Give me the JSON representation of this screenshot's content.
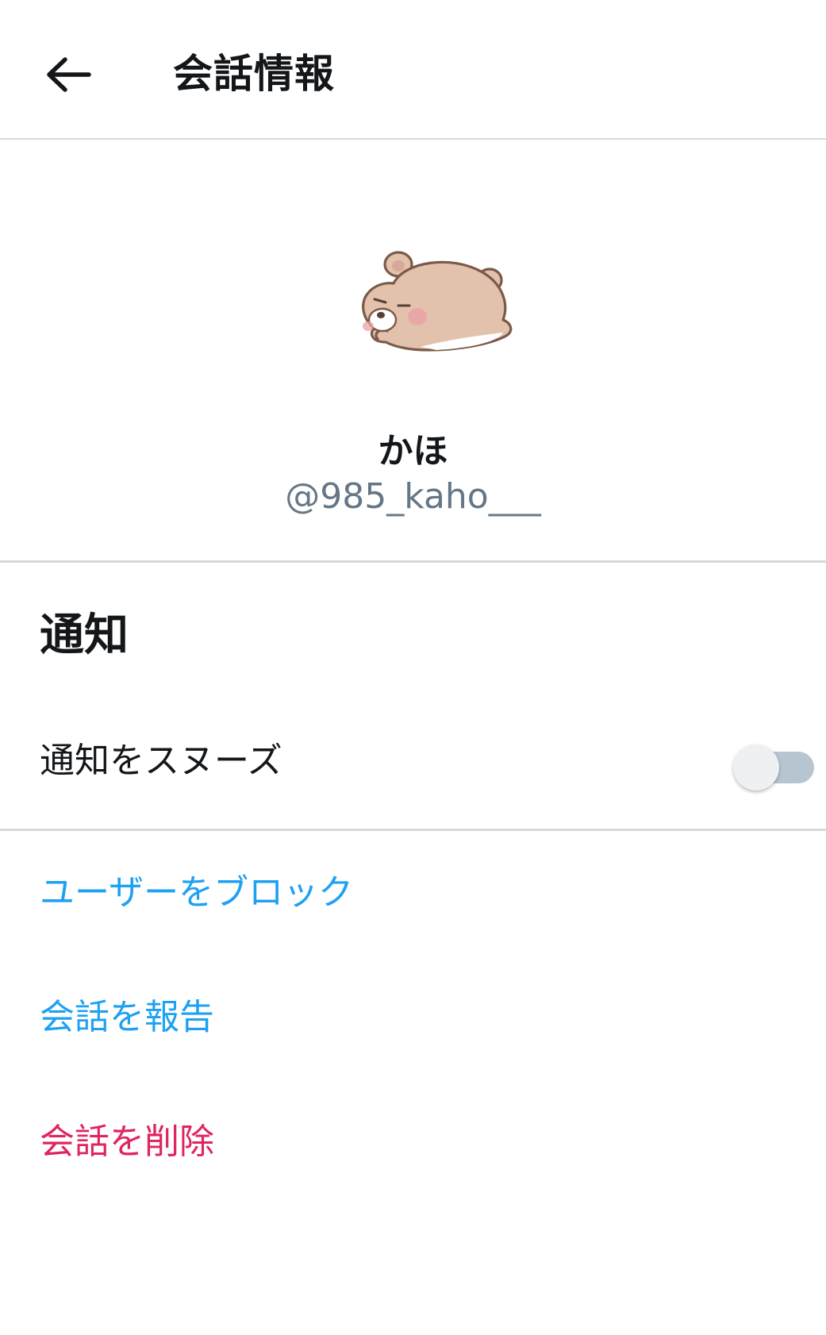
{
  "header": {
    "back_icon": "arrow-left-icon",
    "title": "会話情報"
  },
  "profile": {
    "avatar_icon": "sleeping-bear-avatar",
    "display_name": "かほ",
    "username": "@985_kaho___"
  },
  "notifications": {
    "heading": "通知",
    "snooze_label": "通知をスヌーズ",
    "snooze_enabled": false
  },
  "actions": {
    "block_user": "ユーザーをブロック",
    "report_conversation": "会話を報告",
    "delete_conversation": "会話を削除"
  },
  "colors": {
    "link_blue": "#1da1f2",
    "danger_red": "#e0245e",
    "secondary_text": "#657786",
    "divider": "#d6d9db",
    "toggle_track_off": "#b6c5cf"
  }
}
